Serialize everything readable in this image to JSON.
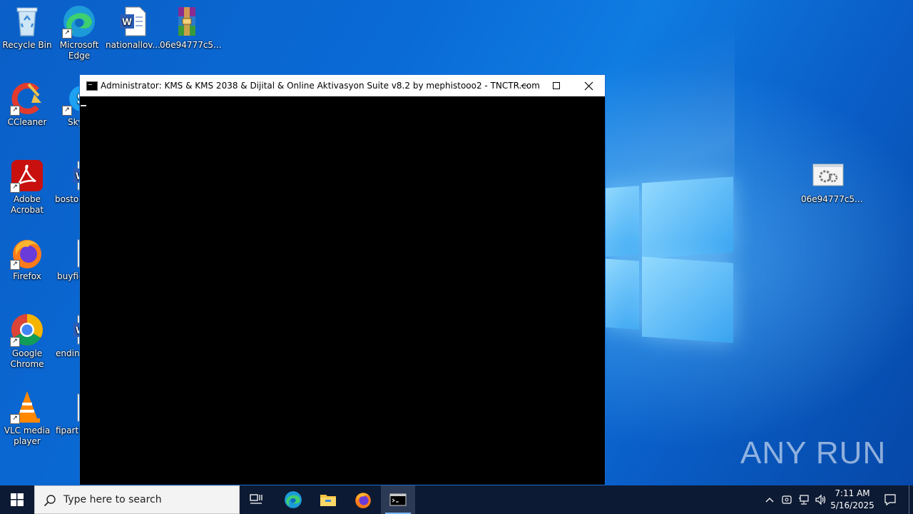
{
  "desktop": {
    "icons": [
      {
        "label": "Recycle Bin"
      },
      {
        "label": "Microsoft Edge"
      },
      {
        "label": "nationallov..."
      },
      {
        "label": "06e94777c5..."
      },
      {
        "label": "CCleaner"
      },
      {
        "label": "Sky"
      },
      {
        "label": "Adobe Acrobat"
      },
      {
        "label": "bostor"
      },
      {
        "label": "Firefox"
      },
      {
        "label": "buyfie"
      },
      {
        "label": "Google Chrome"
      },
      {
        "label": "ending"
      },
      {
        "label": "VLC media player"
      },
      {
        "label": "fiparti"
      },
      {
        "label": "06e94777c5..."
      }
    ]
  },
  "console": {
    "title": "Administrator:  KMS & KMS 2038 & Dijital & Online Aktivasyon Suite v8.2 by mephistooo2 - TNCTR.com"
  },
  "taskbar": {
    "search_placeholder": "Type here to search",
    "time": "7:11 AM",
    "date": "5/16/2025"
  },
  "watermark": {
    "text": "ANY RUN"
  },
  "icons": {
    "start": "windows-start-icon",
    "search": "search-icon",
    "taskview": "task-view-icon",
    "edge": "edge-icon",
    "explorer": "file-explorer-icon",
    "firefox": "firefox-icon",
    "cmd": "command-prompt-icon"
  },
  "colors": {
    "taskbar_bg": "#0d1a33",
    "desktop_bg": "#0a64c8",
    "console_bg": "#000000"
  }
}
